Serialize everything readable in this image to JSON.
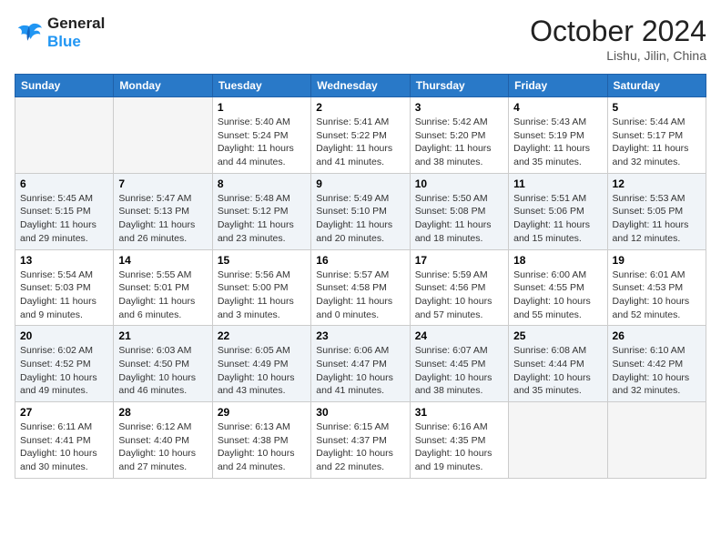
{
  "header": {
    "logo_line1": "General",
    "logo_line2": "Blue",
    "month": "October 2024",
    "location": "Lishu, Jilin, China"
  },
  "weekdays": [
    "Sunday",
    "Monday",
    "Tuesday",
    "Wednesday",
    "Thursday",
    "Friday",
    "Saturday"
  ],
  "weeks": [
    [
      {
        "day": "",
        "info": ""
      },
      {
        "day": "",
        "info": ""
      },
      {
        "day": "1",
        "info": "Sunrise: 5:40 AM\nSunset: 5:24 PM\nDaylight: 11 hours\nand 44 minutes."
      },
      {
        "day": "2",
        "info": "Sunrise: 5:41 AM\nSunset: 5:22 PM\nDaylight: 11 hours\nand 41 minutes."
      },
      {
        "day": "3",
        "info": "Sunrise: 5:42 AM\nSunset: 5:20 PM\nDaylight: 11 hours\nand 38 minutes."
      },
      {
        "day": "4",
        "info": "Sunrise: 5:43 AM\nSunset: 5:19 PM\nDaylight: 11 hours\nand 35 minutes."
      },
      {
        "day": "5",
        "info": "Sunrise: 5:44 AM\nSunset: 5:17 PM\nDaylight: 11 hours\nand 32 minutes."
      }
    ],
    [
      {
        "day": "6",
        "info": "Sunrise: 5:45 AM\nSunset: 5:15 PM\nDaylight: 11 hours\nand 29 minutes."
      },
      {
        "day": "7",
        "info": "Sunrise: 5:47 AM\nSunset: 5:13 PM\nDaylight: 11 hours\nand 26 minutes."
      },
      {
        "day": "8",
        "info": "Sunrise: 5:48 AM\nSunset: 5:12 PM\nDaylight: 11 hours\nand 23 minutes."
      },
      {
        "day": "9",
        "info": "Sunrise: 5:49 AM\nSunset: 5:10 PM\nDaylight: 11 hours\nand 20 minutes."
      },
      {
        "day": "10",
        "info": "Sunrise: 5:50 AM\nSunset: 5:08 PM\nDaylight: 11 hours\nand 18 minutes."
      },
      {
        "day": "11",
        "info": "Sunrise: 5:51 AM\nSunset: 5:06 PM\nDaylight: 11 hours\nand 15 minutes."
      },
      {
        "day": "12",
        "info": "Sunrise: 5:53 AM\nSunset: 5:05 PM\nDaylight: 11 hours\nand 12 minutes."
      }
    ],
    [
      {
        "day": "13",
        "info": "Sunrise: 5:54 AM\nSunset: 5:03 PM\nDaylight: 11 hours\nand 9 minutes."
      },
      {
        "day": "14",
        "info": "Sunrise: 5:55 AM\nSunset: 5:01 PM\nDaylight: 11 hours\nand 6 minutes."
      },
      {
        "day": "15",
        "info": "Sunrise: 5:56 AM\nSunset: 5:00 PM\nDaylight: 11 hours\nand 3 minutes."
      },
      {
        "day": "16",
        "info": "Sunrise: 5:57 AM\nSunset: 4:58 PM\nDaylight: 11 hours\nand 0 minutes."
      },
      {
        "day": "17",
        "info": "Sunrise: 5:59 AM\nSunset: 4:56 PM\nDaylight: 10 hours\nand 57 minutes."
      },
      {
        "day": "18",
        "info": "Sunrise: 6:00 AM\nSunset: 4:55 PM\nDaylight: 10 hours\nand 55 minutes."
      },
      {
        "day": "19",
        "info": "Sunrise: 6:01 AM\nSunset: 4:53 PM\nDaylight: 10 hours\nand 52 minutes."
      }
    ],
    [
      {
        "day": "20",
        "info": "Sunrise: 6:02 AM\nSunset: 4:52 PM\nDaylight: 10 hours\nand 49 minutes."
      },
      {
        "day": "21",
        "info": "Sunrise: 6:03 AM\nSunset: 4:50 PM\nDaylight: 10 hours\nand 46 minutes."
      },
      {
        "day": "22",
        "info": "Sunrise: 6:05 AM\nSunset: 4:49 PM\nDaylight: 10 hours\nand 43 minutes."
      },
      {
        "day": "23",
        "info": "Sunrise: 6:06 AM\nSunset: 4:47 PM\nDaylight: 10 hours\nand 41 minutes."
      },
      {
        "day": "24",
        "info": "Sunrise: 6:07 AM\nSunset: 4:45 PM\nDaylight: 10 hours\nand 38 minutes."
      },
      {
        "day": "25",
        "info": "Sunrise: 6:08 AM\nSunset: 4:44 PM\nDaylight: 10 hours\nand 35 minutes."
      },
      {
        "day": "26",
        "info": "Sunrise: 6:10 AM\nSunset: 4:42 PM\nDaylight: 10 hours\nand 32 minutes."
      }
    ],
    [
      {
        "day": "27",
        "info": "Sunrise: 6:11 AM\nSunset: 4:41 PM\nDaylight: 10 hours\nand 30 minutes."
      },
      {
        "day": "28",
        "info": "Sunrise: 6:12 AM\nSunset: 4:40 PM\nDaylight: 10 hours\nand 27 minutes."
      },
      {
        "day": "29",
        "info": "Sunrise: 6:13 AM\nSunset: 4:38 PM\nDaylight: 10 hours\nand 24 minutes."
      },
      {
        "day": "30",
        "info": "Sunrise: 6:15 AM\nSunset: 4:37 PM\nDaylight: 10 hours\nand 22 minutes."
      },
      {
        "day": "31",
        "info": "Sunrise: 6:16 AM\nSunset: 4:35 PM\nDaylight: 10 hours\nand 19 minutes."
      },
      {
        "day": "",
        "info": ""
      },
      {
        "day": "",
        "info": ""
      }
    ]
  ]
}
